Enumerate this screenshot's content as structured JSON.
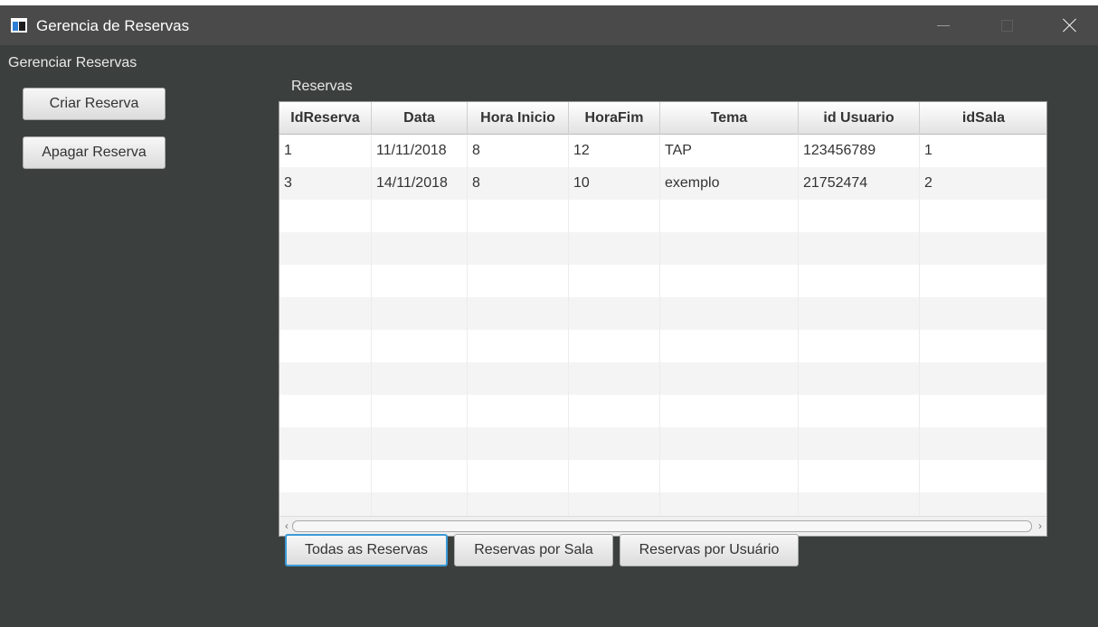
{
  "window": {
    "title": "Gerencia de Reservas",
    "controls": {
      "minimize": "minimize-icon",
      "maximize": "maximize-icon",
      "close": "close-icon"
    }
  },
  "sidebar": {
    "title": "Gerenciar Reservas",
    "criar_label": "Criar Reserva",
    "apagar_label": "Apagar Reserva"
  },
  "table": {
    "label": "Reservas",
    "columns": [
      "IdReserva",
      "Data",
      "Hora Inicio",
      "HoraFim",
      "Tema",
      "id Usuario",
      "idSala"
    ],
    "rows": [
      [
        "1",
        "11/11/2018",
        "8",
        "12",
        "TAP",
        "123456789",
        "1"
      ],
      [
        "3",
        "14/11/2018",
        "8",
        "10",
        "exemplo",
        "21752474",
        "2"
      ]
    ]
  },
  "footer": {
    "todas_label": "Todas as Reservas",
    "sala_label": "Reservas por Sala",
    "usuario_label": "Reservas por Usuário"
  },
  "colors": {
    "background": "#3b403e",
    "titlebar": "#4a4a4a",
    "focus": "#3b9ad6"
  }
}
